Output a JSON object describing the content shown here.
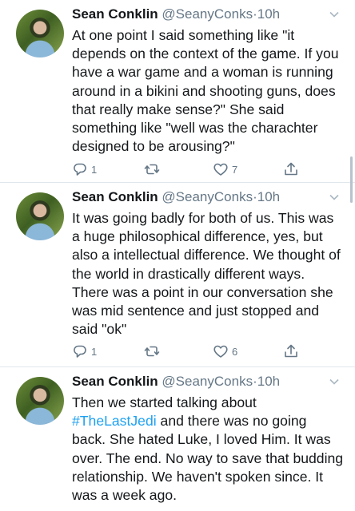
{
  "tweets": [
    {
      "name": "Sean Conklin",
      "handle": "@SeanyConks",
      "dot": "·",
      "time": "10h",
      "text": "At one point I said something like \"it depends on the context of the game. If you have a war game and a woman is running around in a bikini and shooting guns, does that really make sense?\" She said something like \"well was the charachter designed to be arousing?\"",
      "reply_count": "1",
      "retweet_count": "",
      "like_count": "7"
    },
    {
      "name": "Sean Conklin",
      "handle": "@SeanyConks",
      "dot": "·",
      "time": "10h",
      "text": "It was going badly for both of us. This was a huge philosophical difference, yes, but also a intellectual difference. We thought of the world in drastically different ways. There was a point in our conversation she was mid sentence and just stopped and said \"ok\"",
      "reply_count": "1",
      "retweet_count": "",
      "like_count": "6"
    },
    {
      "name": "Sean Conklin",
      "handle": "@SeanyConks",
      "dot": "·",
      "time": "10h",
      "text_before": "Then we started talking about",
      "hashtag": "#TheLastJedi",
      "text_after": "and there was no going back. She hated Luke, I loved Him. It was over. The end. No way to save that budding relationship. We haven't spoken since. It was a week ago.",
      "reply_count": "",
      "retweet_count": "",
      "like_count": ""
    }
  ],
  "icons": {
    "reply": "reply-icon",
    "retweet": "retweet-icon",
    "like": "heart-icon",
    "share": "share-icon",
    "caret": "chevron-down-icon"
  },
  "colors": {
    "text": "#14171a",
    "secondary": "#657786",
    "link": "#1da1f2",
    "divider": "#e1e8ed"
  }
}
